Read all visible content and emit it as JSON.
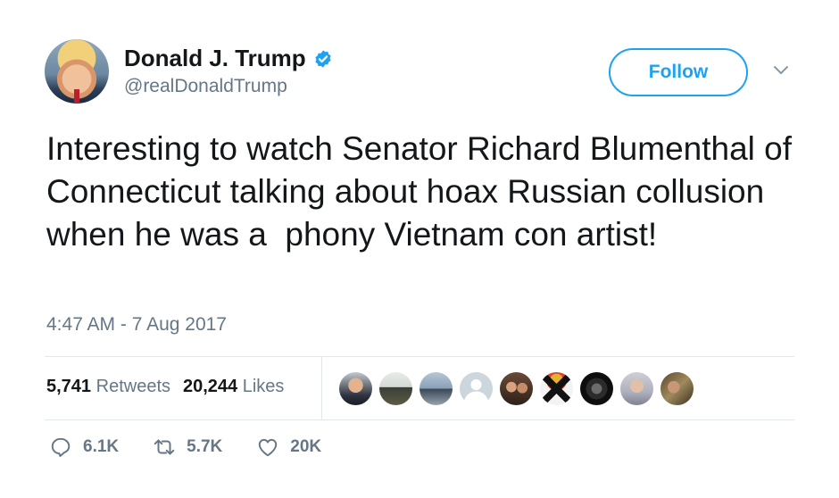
{
  "author": {
    "name": "Donald J. Trump",
    "handle": "@realDonaldTrump",
    "verified": true
  },
  "follow_label": "Follow",
  "tweet": {
    "text": "Interesting to watch Senator Richard Blumenthal of Connecticut talking about hoax Russian collusion when he was a  phony Vietnam con artist!",
    "timestamp": "4:47 AM - 7 Aug 2017"
  },
  "stats": {
    "retweets_count": "5,741",
    "retweets_label": "Retweets",
    "likes_count": "20,244",
    "likes_label": "Likes"
  },
  "actions": {
    "replies": "6.1K",
    "retweets": "5.7K",
    "likes": "20K"
  },
  "colors": {
    "accent": "#1da1f2",
    "verified": "#1da1f2",
    "muted_text": "#657786",
    "divider": "#e1e8ed"
  },
  "icons": [
    "verified-badge-icon",
    "chevron-down-icon",
    "reply-icon",
    "retweet-icon",
    "like-icon"
  ]
}
